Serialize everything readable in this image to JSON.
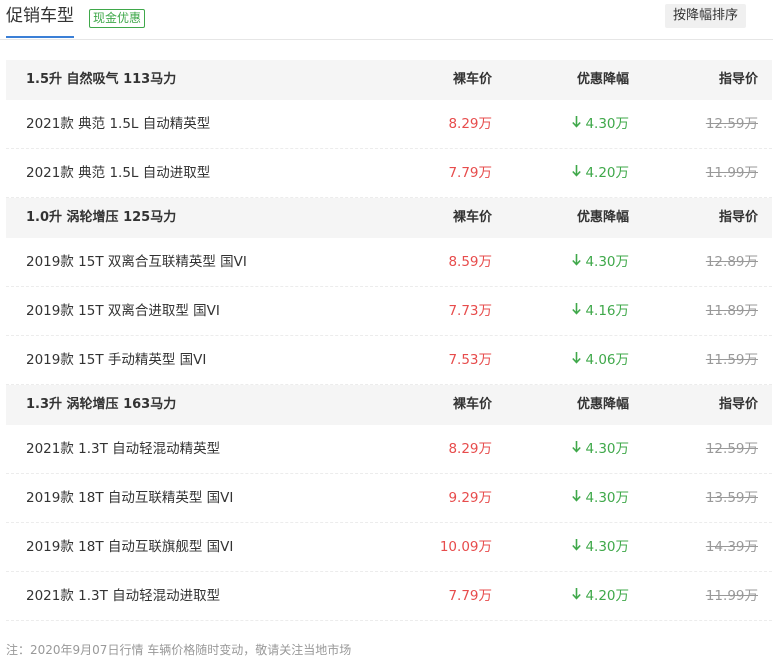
{
  "header": {
    "title": "促销车型",
    "badge": "现金优惠",
    "sort_button": "按降幅排序"
  },
  "columns": {
    "price": "裸车价",
    "discount": "优惠降幅",
    "guide": "指导价"
  },
  "groups": [
    {
      "title": "1.5升 自然吸气 113马力",
      "rows": [
        {
          "name": "2021款 典范 1.5L 自动精英型",
          "price": "8.29万",
          "discount": "4.30万",
          "guide": "12.59万"
        },
        {
          "name": "2021款 典范 1.5L 自动进取型",
          "price": "7.79万",
          "discount": "4.20万",
          "guide": "11.99万"
        }
      ]
    },
    {
      "title": "1.0升 涡轮增压 125马力",
      "rows": [
        {
          "name": "2019款 15T 双离合互联精英型 国VI",
          "price": "8.59万",
          "discount": "4.30万",
          "guide": "12.89万"
        },
        {
          "name": "2019款 15T 双离合进取型 国VI",
          "price": "7.73万",
          "discount": "4.16万",
          "guide": "11.89万"
        },
        {
          "name": "2019款 15T 手动精英型 国VI",
          "price": "7.53万",
          "discount": "4.06万",
          "guide": "11.59万"
        }
      ]
    },
    {
      "title": "1.3升 涡轮增压 163马力",
      "rows": [
        {
          "name": "2021款 1.3T 自动轻混动精英型",
          "price": "8.29万",
          "discount": "4.30万",
          "guide": "12.59万"
        },
        {
          "name": "2019款 18T 自动互联精英型 国VI",
          "price": "9.29万",
          "discount": "4.30万",
          "guide": "13.59万"
        },
        {
          "name": "2019款 18T 自动互联旗舰型 国VI",
          "price": "10.09万",
          "discount": "4.30万",
          "guide": "14.39万"
        },
        {
          "name": "2021款 1.3T 自动轻混动进取型",
          "price": "7.79万",
          "discount": "4.20万",
          "guide": "11.99万"
        }
      ]
    }
  ],
  "note": "注：2020年9月07日行情 车辆价格随时变动，敬请关注当地市场",
  "colors": {
    "accent": "#3b7fd6",
    "price": "#e74c4c",
    "discount": "#3fa84a",
    "guide": "#999999"
  },
  "icons": {
    "discount_arrow": "arrow-down-icon"
  }
}
